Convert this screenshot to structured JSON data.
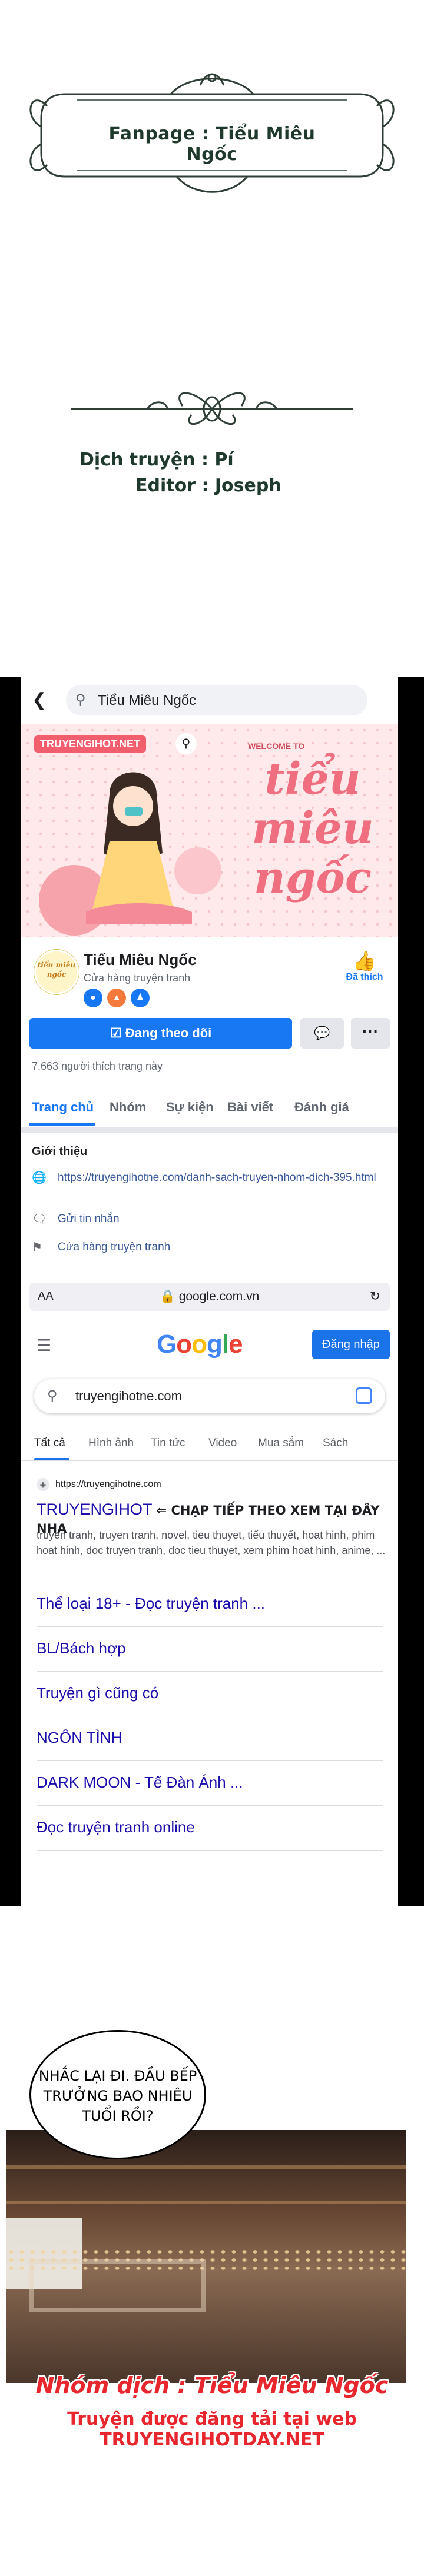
{
  "credits": {
    "fanpage": "Fanpage : Tiểu Miêu Ngốc",
    "translator": "Dịch truyện : Pí",
    "editor": "Editor : Joseph"
  },
  "fb": {
    "search_text": "Tiểu Miêu Ngốc",
    "cover": {
      "brand": "TRUYENGIHOT.NET",
      "welcome": "WELCOME TO",
      "script_lines": [
        "tiểu",
        "miêu",
        "ngốc"
      ]
    },
    "avatar_text": "tiểu miêu ngốc",
    "page_name": "Tiểu Miêu Ngốc",
    "category": "Cửa hàng truyện tranh",
    "liked_label": "Đã thích",
    "follow_label": "Đang theo dõi",
    "more_label": "···",
    "likes": "7.663 người thích trang này",
    "tabs": [
      "Trang chủ",
      "Nhóm",
      "Sự kiện",
      "Bài viết",
      "Đánh giá"
    ],
    "intro_heading": "Giới thiệu",
    "intro_link": "https://truyengihotne.com/danh-sach-truyen-nhom-dich-395.html",
    "message_label": "Gửi tin nhắn",
    "store_label": "Cửa hàng truyện tranh"
  },
  "browser": {
    "aa": "AA",
    "url": "google.com.vn"
  },
  "google": {
    "signin": "Đăng nhập",
    "query": "truyengihotne.com",
    "tabs": [
      "Tất cả",
      "Hình ảnh",
      "Tin tức",
      "Video",
      "Mua sắm",
      "Sách"
    ],
    "site_url": "https://truyengihotne.com",
    "result_title": "TRUYENGIHOT",
    "result_banner": "⇐ CHẠP TIẾP THEO XEM TẠI ĐÂY NHA",
    "snippet": "truyen tranh, truyen tranh, novel, tieu thuyet, tiểu thuyết, hoat hinh, phim hoat hinh, doc truyen tranh, doc tieu thuyet, xem phim hoat hinh, anime, ...",
    "sitelinks": [
      "Thể loại 18+ - Đọc truyện tranh ...",
      "BL/Bách hợp",
      "Truyện gì cũng có",
      "NGÔN TÌNH",
      "DARK MOON - Tế Đàn Ánh ...",
      "Đọc truyện tranh online"
    ]
  },
  "comic": {
    "bubble": "NHẮC LẠI ĐI. ĐẦU BẾP TRƯỞNG BAO NHIÊU TUỔI RỒI?"
  },
  "footer": {
    "group": "Nhóm dịch : Tiểu Miêu Ngốc",
    "upload": "Truyện được đăng tải tại web TRUYENGIHOTDAY.NET"
  }
}
